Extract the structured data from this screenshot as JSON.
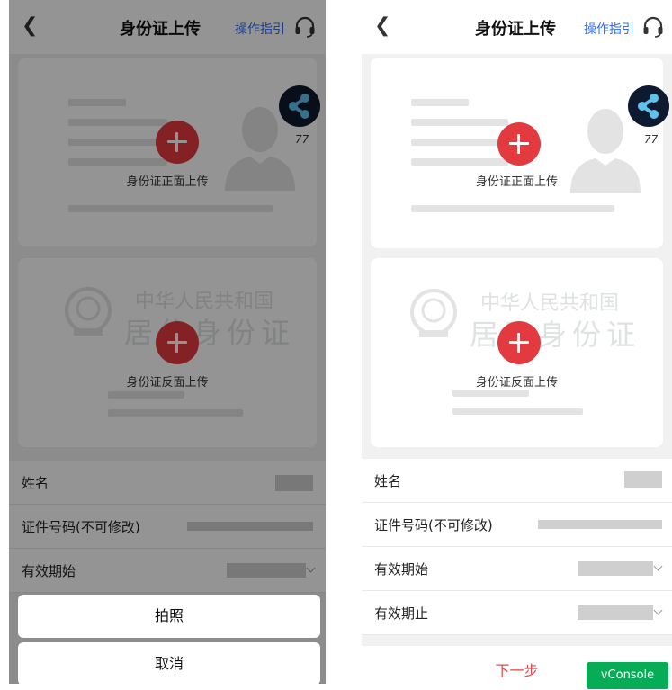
{
  "screen": {
    "back_icon": "chevron-left-icon",
    "title": "身份证上传",
    "guide_link": "操作指引",
    "support_icon": "headset-icon"
  },
  "id_front": {
    "caption": "身份证正面上传",
    "add_icon": "plus-icon"
  },
  "id_back": {
    "caption": "身份证反面上传",
    "add_icon": "plus-icon",
    "watermark_line1": "中华人民共和国",
    "watermark_line2_left": "居民身份证",
    "watermark_line2_right": "居住身份证"
  },
  "floating_widget": {
    "icon": "share-node-icon",
    "count": "77"
  },
  "form": {
    "name_label": "姓名",
    "id_number_label": "证件号码(不可修改)",
    "valid_from_label": "有效期始",
    "valid_to_label": "有效期止"
  },
  "next_button": "下一步",
  "vconsole_label": "vConsole",
  "action_sheet": {
    "take_photo": "拍照",
    "cancel": "取消"
  },
  "colors": {
    "accent_red": "#e23a3f",
    "link_blue": "#2d6df0",
    "vconsole_green": "#06ad56",
    "widget_dark": "#0e1a30"
  }
}
